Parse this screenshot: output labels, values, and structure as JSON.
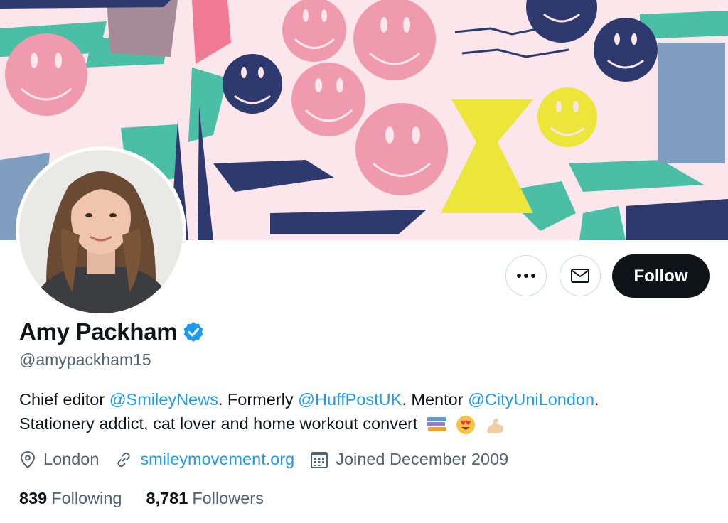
{
  "profile": {
    "name": "Amy Packham",
    "handle": "@amypackham15",
    "bio": {
      "p1": "Chief editor ",
      "m1": "@SmileyNews",
      "p2": ". Formerly ",
      "m2": "@HuffPostUK",
      "p3": ". Mentor ",
      "m3": "@CityUniLondon",
      "p4": ".",
      "line2": "Stationery addict, cat lover and home workout convert"
    },
    "location": "London",
    "website": "smileymovement.org",
    "joined": "Joined December 2009",
    "following_count": "839",
    "following_label": "Following",
    "followers_count": "8,781",
    "followers_label": "Followers"
  },
  "actions": {
    "follow_label": "Follow"
  },
  "icons": {
    "more": "more-icon",
    "message": "envelope-icon",
    "verified": "verified-badge-icon",
    "location": "location-pin-icon",
    "link": "link-icon",
    "calendar": "calendar-icon"
  },
  "colors": {
    "accent": "#1d9bf0",
    "text": "#0f1419",
    "muted": "#536471",
    "button": "#0f1419"
  }
}
